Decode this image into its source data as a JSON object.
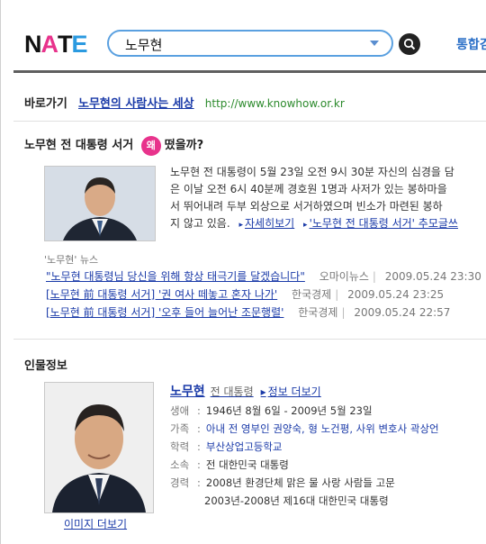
{
  "header": {
    "logo": "NATE",
    "query": "노무현",
    "integrated_tab": "통합검"
  },
  "shortcut": {
    "label": "바로가기",
    "site_name": "노무현의 사람사는 세상",
    "url": "http://www.knowhow.or.kr"
  },
  "headline": {
    "prefix": "노무현 전 대통령 서거",
    "badge": "왜",
    "suffix": "떴을까?"
  },
  "summary": {
    "line1": "노무현 전 대통령이 5월 23일 오전 9시 30분 자신의 심경을 담",
    "line2": "은 이날 오전 6시 40분께 경호원 1명과 사저가 있는 봉하마을",
    "line3": "서 뛰어내려 두부 외상으로 서거하였으며 빈소가 마련된 봉하",
    "line4_text": "지 않고 있음.",
    "more_link": "자세히보기",
    "memorial_link": "'노무현 전 대통령 서거' 추모글쓰"
  },
  "news": {
    "heading": "'노무현' 뉴스",
    "items": [
      {
        "title": "\"노무현 대통령님 당신을 위해 항상 태극기를 달겠습니다\"",
        "source": "오마이뉴스",
        "date": "2009.05.24 23:30"
      },
      {
        "title": "[노무현 前 대통령 서거] '권 여사 떼놓고 혼자 나가'",
        "source": "한국경제",
        "date": "2009.05.24 23:25"
      },
      {
        "title": "[노무현 前 대통령 서거] '오후 들어 늘어난 조문행렬'",
        "source": "한국경제",
        "date": "2009.05.24 22:57"
      }
    ]
  },
  "person": {
    "section_title": "인물정보",
    "name": "노무현",
    "role": "전 대통령",
    "more_info": "정보 더보기",
    "rows": [
      {
        "key": "생애",
        "value": "1946년 8월 6일 - 2009년 5월 23일"
      },
      {
        "key": "가족",
        "value": "아내 전 영부인 권양숙, 형 노건평, 사위 변호사 곽상언"
      },
      {
        "key": "학력",
        "value": "부산상업고등학교"
      },
      {
        "key": "소속",
        "value": "전 대한민국 대통령"
      },
      {
        "key": "경력",
        "value": "2008년 환경단체 맑은 물 사랑 사람들 고문"
      }
    ],
    "career_line2": "2003년-2008년 제16대 대한민국 대통령",
    "more_images": "이미지 더보기"
  }
}
